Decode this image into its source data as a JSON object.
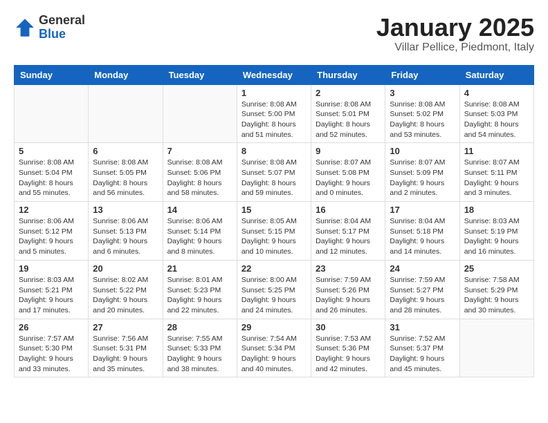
{
  "logo": {
    "general": "General",
    "blue": "Blue"
  },
  "header": {
    "month": "January 2025",
    "location": "Villar Pellice, Piedmont, Italy"
  },
  "weekdays": [
    "Sunday",
    "Monday",
    "Tuesday",
    "Wednesday",
    "Thursday",
    "Friday",
    "Saturday"
  ],
  "weeks": [
    [
      {
        "day": "",
        "info": ""
      },
      {
        "day": "",
        "info": ""
      },
      {
        "day": "",
        "info": ""
      },
      {
        "day": "1",
        "info": "Sunrise: 8:08 AM\nSunset: 5:00 PM\nDaylight: 8 hours\nand 51 minutes."
      },
      {
        "day": "2",
        "info": "Sunrise: 8:08 AM\nSunset: 5:01 PM\nDaylight: 8 hours\nand 52 minutes."
      },
      {
        "day": "3",
        "info": "Sunrise: 8:08 AM\nSunset: 5:02 PM\nDaylight: 8 hours\nand 53 minutes."
      },
      {
        "day": "4",
        "info": "Sunrise: 8:08 AM\nSunset: 5:03 PM\nDaylight: 8 hours\nand 54 minutes."
      }
    ],
    [
      {
        "day": "5",
        "info": "Sunrise: 8:08 AM\nSunset: 5:04 PM\nDaylight: 8 hours\nand 55 minutes."
      },
      {
        "day": "6",
        "info": "Sunrise: 8:08 AM\nSunset: 5:05 PM\nDaylight: 8 hours\nand 56 minutes."
      },
      {
        "day": "7",
        "info": "Sunrise: 8:08 AM\nSunset: 5:06 PM\nDaylight: 8 hours\nand 58 minutes."
      },
      {
        "day": "8",
        "info": "Sunrise: 8:08 AM\nSunset: 5:07 PM\nDaylight: 8 hours\nand 59 minutes."
      },
      {
        "day": "9",
        "info": "Sunrise: 8:07 AM\nSunset: 5:08 PM\nDaylight: 9 hours\nand 0 minutes."
      },
      {
        "day": "10",
        "info": "Sunrise: 8:07 AM\nSunset: 5:09 PM\nDaylight: 9 hours\nand 2 minutes."
      },
      {
        "day": "11",
        "info": "Sunrise: 8:07 AM\nSunset: 5:11 PM\nDaylight: 9 hours\nand 3 minutes."
      }
    ],
    [
      {
        "day": "12",
        "info": "Sunrise: 8:06 AM\nSunset: 5:12 PM\nDaylight: 9 hours\nand 5 minutes."
      },
      {
        "day": "13",
        "info": "Sunrise: 8:06 AM\nSunset: 5:13 PM\nDaylight: 9 hours\nand 6 minutes."
      },
      {
        "day": "14",
        "info": "Sunrise: 8:06 AM\nSunset: 5:14 PM\nDaylight: 9 hours\nand 8 minutes."
      },
      {
        "day": "15",
        "info": "Sunrise: 8:05 AM\nSunset: 5:15 PM\nDaylight: 9 hours\nand 10 minutes."
      },
      {
        "day": "16",
        "info": "Sunrise: 8:04 AM\nSunset: 5:17 PM\nDaylight: 9 hours\nand 12 minutes."
      },
      {
        "day": "17",
        "info": "Sunrise: 8:04 AM\nSunset: 5:18 PM\nDaylight: 9 hours\nand 14 minutes."
      },
      {
        "day": "18",
        "info": "Sunrise: 8:03 AM\nSunset: 5:19 PM\nDaylight: 9 hours\nand 16 minutes."
      }
    ],
    [
      {
        "day": "19",
        "info": "Sunrise: 8:03 AM\nSunset: 5:21 PM\nDaylight: 9 hours\nand 17 minutes."
      },
      {
        "day": "20",
        "info": "Sunrise: 8:02 AM\nSunset: 5:22 PM\nDaylight: 9 hours\nand 20 minutes."
      },
      {
        "day": "21",
        "info": "Sunrise: 8:01 AM\nSunset: 5:23 PM\nDaylight: 9 hours\nand 22 minutes."
      },
      {
        "day": "22",
        "info": "Sunrise: 8:00 AM\nSunset: 5:25 PM\nDaylight: 9 hours\nand 24 minutes."
      },
      {
        "day": "23",
        "info": "Sunrise: 7:59 AM\nSunset: 5:26 PM\nDaylight: 9 hours\nand 26 minutes."
      },
      {
        "day": "24",
        "info": "Sunrise: 7:59 AM\nSunset: 5:27 PM\nDaylight: 9 hours\nand 28 minutes."
      },
      {
        "day": "25",
        "info": "Sunrise: 7:58 AM\nSunset: 5:29 PM\nDaylight: 9 hours\nand 30 minutes."
      }
    ],
    [
      {
        "day": "26",
        "info": "Sunrise: 7:57 AM\nSunset: 5:30 PM\nDaylight: 9 hours\nand 33 minutes."
      },
      {
        "day": "27",
        "info": "Sunrise: 7:56 AM\nSunset: 5:31 PM\nDaylight: 9 hours\nand 35 minutes."
      },
      {
        "day": "28",
        "info": "Sunrise: 7:55 AM\nSunset: 5:33 PM\nDaylight: 9 hours\nand 38 minutes."
      },
      {
        "day": "29",
        "info": "Sunrise: 7:54 AM\nSunset: 5:34 PM\nDaylight: 9 hours\nand 40 minutes."
      },
      {
        "day": "30",
        "info": "Sunrise: 7:53 AM\nSunset: 5:36 PM\nDaylight: 9 hours\nand 42 minutes."
      },
      {
        "day": "31",
        "info": "Sunrise: 7:52 AM\nSunset: 5:37 PM\nDaylight: 9 hours\nand 45 minutes."
      },
      {
        "day": "",
        "info": ""
      }
    ]
  ]
}
